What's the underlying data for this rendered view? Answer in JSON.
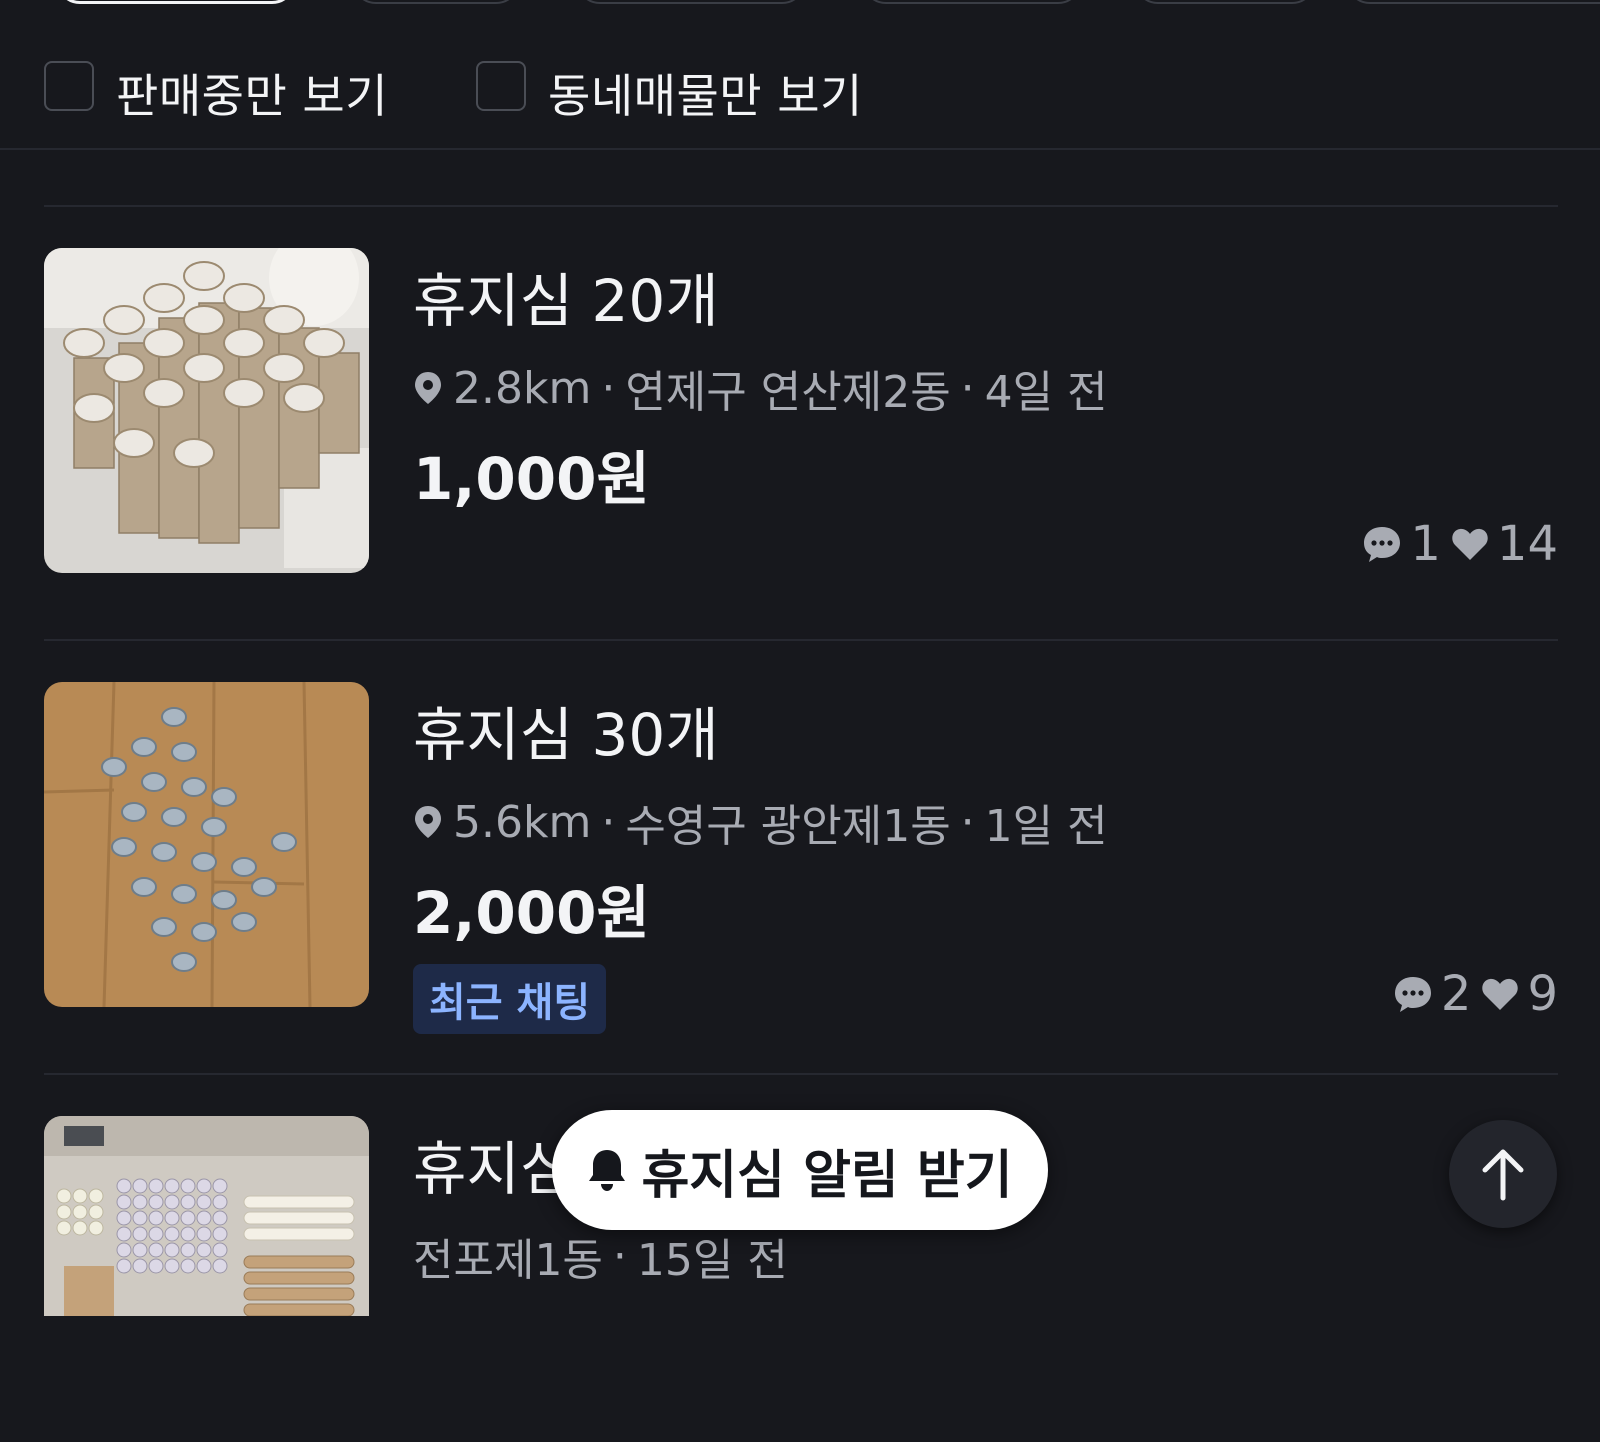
{
  "filters": {
    "on_sale_only": "판매중만 보기",
    "neighborhood_only": "동네매물만 보기"
  },
  "listings": [
    {
      "title": "휴지심 20개",
      "distance": "2.8km",
      "location": "연제구 연산제2동",
      "time": "4일 전",
      "price": "1,000원",
      "chats": "1",
      "likes": "14"
    },
    {
      "title": "휴지심 30개",
      "distance": "5.6km",
      "location": "수영구 광안제1동",
      "time": "1일 전",
      "price": "2,000원",
      "badge": "최근 채팅",
      "chats": "2",
      "likes": "9"
    },
    {
      "title": "휴지심",
      "location": "전포제1동",
      "time": "15일 전"
    }
  ],
  "separator": "·",
  "alert_button": "휴지심 알림 받기",
  "icons": {
    "location": "pin-icon",
    "chat": "chat-bubble-icon",
    "like": "heart-icon",
    "alert": "bell-icon",
    "scroll_top": "arrow-up-icon"
  },
  "colors": {
    "background": "#17181d",
    "badge_bg": "#1e2a48",
    "badge_text": "#8cb4ff"
  }
}
